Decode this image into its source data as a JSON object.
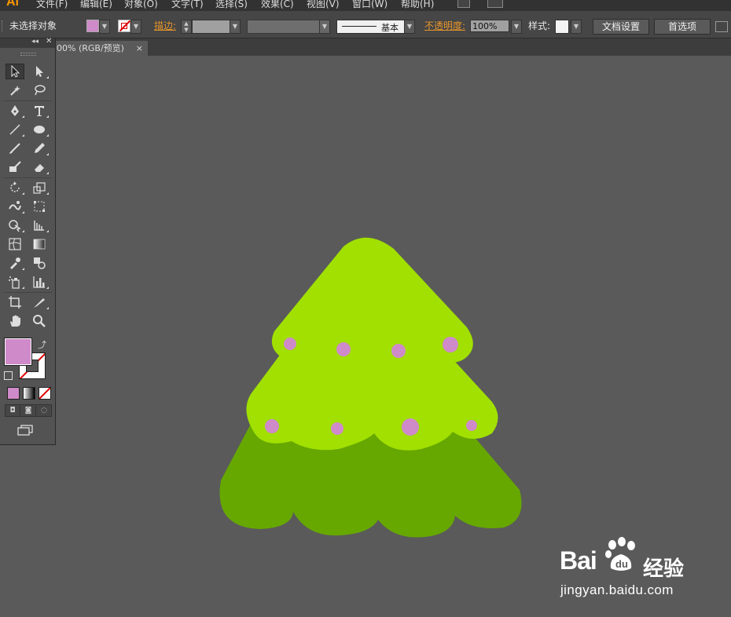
{
  "app": {
    "logo": "Ai"
  },
  "menu": [
    "文件(F)",
    "编辑(E)",
    "对象(O)",
    "文字(T)",
    "选择(S)",
    "效果(C)",
    "视图(V)",
    "窗口(W)",
    "帮助(H)"
  ],
  "control_bar": {
    "selection_status": "未选择对象",
    "stroke_label": "描边:",
    "brush_label": "基本",
    "opacity_label": "不透明度:",
    "opacity_value": "100%",
    "style_label": "样式:",
    "doc_settings": "文档设置",
    "preferences": "首选项",
    "fill_color": "#cf8ac9"
  },
  "document_tab": {
    "title": "00% (RGB/预览)",
    "close": "×"
  },
  "tools_panel": {
    "fill_color": "#cf8ac9",
    "stroke": "none",
    "tools": [
      "selection",
      "direct-selection",
      "magic-wand",
      "lasso",
      "pen",
      "type",
      "line-segment",
      "ellipse",
      "paintbrush",
      "pencil",
      "blob-brush",
      "eraser",
      "rotate",
      "scale",
      "warp",
      "free-transform",
      "shape-builder",
      "graph",
      "mesh",
      "gradient",
      "eyedropper",
      "blend",
      "symbol-sprayer",
      "column-graph",
      "artboard",
      "slice",
      "hand",
      "zoom"
    ]
  },
  "artwork": {
    "description_colors": {
      "light_green": "#a1e000",
      "dark_green": "#66a800",
      "ornament": "#cf8ac9"
    }
  },
  "watermark": {
    "brand": "Bai",
    "brand_cn": "经验",
    "url": "jingyan.baidu.com"
  }
}
